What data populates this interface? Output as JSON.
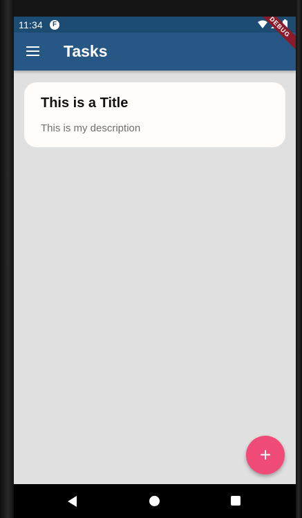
{
  "status_bar": {
    "time": "11:34",
    "app_icon_glyph": "F"
  },
  "app_bar": {
    "title": "Tasks",
    "menu_icon": "menu-icon"
  },
  "debug_banner": {
    "label": "DEBUG"
  },
  "tasks": [
    {
      "title": "This is a Title",
      "description": "This is my description"
    }
  ],
  "fab": {
    "label": "+",
    "icon": "add-icon"
  },
  "navigation": {
    "back_icon": "back-icon",
    "home_icon": "home-icon",
    "recents_icon": "recents-icon"
  },
  "colors": {
    "status_bar": "#1d4c73",
    "app_bar": "#275784",
    "background": "#e0e0e0",
    "card": "#fffcf9",
    "fab": "#f04a79",
    "debug_banner": "#8b1b2a"
  }
}
